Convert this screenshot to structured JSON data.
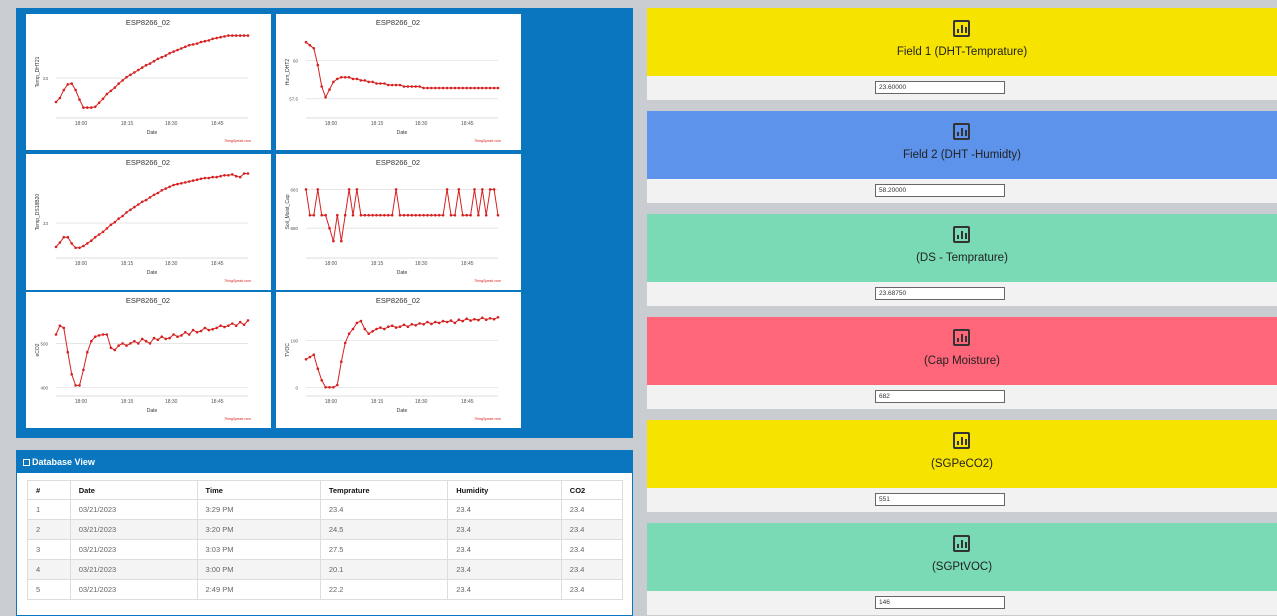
{
  "charts": [
    {
      "title": "ESP8266_02",
      "ylabel": "Temp_DHT21",
      "xlabel": "Date",
      "brand": "ThingSpeak.com",
      "yticks": [
        "23"
      ],
      "xticks": [
        "18:00",
        "18:15",
        "18:30",
        "18:45"
      ]
    },
    {
      "title": "ESP8266_02",
      "ylabel": "Hum_DHT2",
      "xlabel": "Date",
      "brand": "ThingSpeak.com",
      "yticks": [
        "60",
        "57.5"
      ],
      "xticks": [
        "18:00",
        "18:15",
        "18:30",
        "18:45"
      ]
    },
    {
      "title": "ESP8266_02",
      "ylabel": "Temp_DS18B20",
      "xlabel": "Date",
      "brand": "ThingSpeak.com",
      "yticks": [
        "23"
      ],
      "xticks": [
        "18:00",
        "18:15",
        "18:30",
        "18:45"
      ]
    },
    {
      "title": "ESP8266_02",
      "ylabel": "Soil_Moist_Cap",
      "xlabel": "Date",
      "brand": "ThingSpeak.com",
      "yticks": [
        "683",
        "680"
      ],
      "xticks": [
        "18:00",
        "18:15",
        "18:30",
        "18:45"
      ]
    },
    {
      "title": "ESP8266_02",
      "ylabel": "eCO2",
      "xlabel": "Date",
      "brand": "ThingSpeak.com",
      "yticks": [
        "500",
        "400"
      ],
      "xticks": [
        "18:00",
        "18:15",
        "18:30",
        "18:45"
      ]
    },
    {
      "title": "ESP8266_02",
      "ylabel": "TVOC",
      "xlabel": "Date",
      "brand": "ThingSpeak.com",
      "yticks": [
        "100",
        "0"
      ],
      "xticks": [
        "18:00",
        "18:15",
        "18:30",
        "18:45"
      ]
    }
  ],
  "chart_data": [
    {
      "type": "line",
      "title": "ESP8266_02",
      "xlabel": "Date",
      "ylabel": "Temp_DHT21",
      "color": "#d62020",
      "x": [
        0,
        1,
        2,
        3,
        4,
        5,
        6,
        7,
        8,
        9,
        10,
        11,
        12,
        13,
        14,
        15,
        16,
        17,
        18,
        19,
        20,
        21,
        22,
        23,
        24,
        25,
        26,
        27,
        28,
        29,
        30,
        31,
        32,
        33,
        34,
        35,
        36,
        37,
        38,
        39,
        40,
        41,
        42,
        43,
        44,
        45,
        46,
        47,
        48,
        49
      ],
      "y": [
        20.0,
        20.5,
        21.5,
        22.2,
        22.3,
        21.5,
        20.3,
        19.3,
        19.3,
        19.3,
        19.4,
        19.9,
        20.4,
        21.0,
        21.4,
        21.8,
        22.3,
        22.7,
        23.1,
        23.4,
        23.7,
        24.0,
        24.3,
        24.6,
        24.8,
        25.1,
        25.4,
        25.6,
        25.8,
        26.1,
        26.3,
        26.5,
        26.7,
        26.9,
        27.1,
        27.2,
        27.3,
        27.5,
        27.6,
        27.7,
        27.9,
        28.0,
        28.1,
        28.2,
        28.3,
        28.3,
        28.3,
        28.3,
        28.3,
        28.3
      ]
    },
    {
      "type": "line",
      "title": "ESP8266_02",
      "xlabel": "Date",
      "ylabel": "Hum_DHT2",
      "color": "#d62020",
      "x": [
        0,
        1,
        2,
        3,
        4,
        5,
        6,
        7,
        8,
        9,
        10,
        11,
        12,
        13,
        14,
        15,
        16,
        17,
        18,
        19,
        20,
        21,
        22,
        23,
        24,
        25,
        26,
        27,
        28,
        29,
        30,
        31,
        32,
        33,
        34,
        35,
        36,
        37,
        38,
        39,
        40,
        41,
        42,
        43,
        44,
        45,
        46,
        47,
        48,
        49
      ],
      "y": [
        61.2,
        61.0,
        60.8,
        59.7,
        58.3,
        57.6,
        58.1,
        58.6,
        58.8,
        58.9,
        58.9,
        58.9,
        58.8,
        58.8,
        58.7,
        58.7,
        58.6,
        58.6,
        58.5,
        58.5,
        58.5,
        58.4,
        58.4,
        58.4,
        58.4,
        58.3,
        58.3,
        58.3,
        58.3,
        58.3,
        58.2,
        58.2,
        58.2,
        58.2,
        58.2,
        58.2,
        58.2,
        58.2,
        58.2,
        58.2,
        58.2,
        58.2,
        58.2,
        58.2,
        58.2,
        58.2,
        58.2,
        58.2,
        58.2,
        58.2
      ]
    },
    {
      "type": "line",
      "title": "ESP8266_02",
      "xlabel": "Date",
      "ylabel": "Temp_DS18B20",
      "color": "#d62020",
      "x": [
        0,
        1,
        2,
        3,
        4,
        5,
        6,
        7,
        8,
        9,
        10,
        11,
        12,
        13,
        14,
        15,
        16,
        17,
        18,
        19,
        20,
        21,
        22,
        23,
        24,
        25,
        26,
        27,
        28,
        29,
        30,
        31,
        32,
        33,
        34,
        35,
        36,
        37,
        38,
        39,
        40,
        41,
        42,
        43,
        44,
        45,
        46,
        47,
        48,
        49
      ],
      "y": [
        20.3,
        20.8,
        21.4,
        21.4,
        20.7,
        20.2,
        20.2,
        20.4,
        20.7,
        21.0,
        21.4,
        21.7,
        22.0,
        22.4,
        22.8,
        23.1,
        23.5,
        23.8,
        24.2,
        24.5,
        24.8,
        25.1,
        25.4,
        25.6,
        25.9,
        26.2,
        26.4,
        26.7,
        26.9,
        27.1,
        27.3,
        27.4,
        27.5,
        27.6,
        27.7,
        27.8,
        27.9,
        28.0,
        28.1,
        28.1,
        28.2,
        28.2,
        28.3,
        28.4,
        28.4,
        28.5,
        28.3,
        28.2,
        28.6,
        28.6
      ]
    },
    {
      "type": "line",
      "title": "ESP8266_02",
      "xlabel": "Date",
      "ylabel": "Soil_Moist_Cap",
      "color": "#d62020",
      "x": [
        0,
        1,
        2,
        3,
        4,
        5,
        6,
        7,
        8,
        9,
        10,
        11,
        12,
        13,
        14,
        15,
        16,
        17,
        18,
        19,
        20,
        21,
        22,
        23,
        24,
        25,
        26,
        27,
        28,
        29,
        30,
        31,
        32,
        33,
        34,
        35,
        36,
        37,
        38,
        39,
        40,
        41,
        42,
        43,
        44,
        45,
        46,
        47,
        48,
        49
      ],
      "y": [
        683,
        681,
        681,
        683,
        681,
        681,
        680,
        679,
        681,
        679,
        681,
        683,
        681,
        683,
        681,
        681,
        681,
        681,
        681,
        681,
        681,
        681,
        681,
        683,
        681,
        681,
        681,
        681,
        681,
        681,
        681,
        681,
        681,
        681,
        681,
        681,
        683,
        681,
        681,
        683,
        681,
        681,
        681,
        683,
        681,
        683,
        681,
        683,
        683,
        681
      ]
    },
    {
      "type": "line",
      "title": "ESP8266_02",
      "xlabel": "Date",
      "ylabel": "eCO2",
      "color": "#d62020",
      "x": [
        0,
        1,
        2,
        3,
        4,
        5,
        6,
        7,
        8,
        9,
        10,
        11,
        12,
        13,
        14,
        15,
        16,
        17,
        18,
        19,
        20,
        21,
        22,
        23,
        24,
        25,
        26,
        27,
        28,
        29,
        30,
        31,
        32,
        33,
        34,
        35,
        36,
        37,
        38,
        39,
        40,
        41,
        42,
        43,
        44,
        45,
        46,
        47,
        48,
        49
      ],
      "y": [
        520,
        540,
        535,
        480,
        430,
        405,
        405,
        440,
        480,
        505,
        515,
        518,
        520,
        520,
        490,
        485,
        495,
        500,
        495,
        500,
        505,
        500,
        510,
        505,
        500,
        512,
        508,
        515,
        510,
        512,
        520,
        515,
        518,
        525,
        520,
        530,
        525,
        528,
        535,
        530,
        532,
        535,
        540,
        537,
        540,
        545,
        540,
        548,
        542,
        552
      ]
    },
    {
      "type": "line",
      "title": "ESP8266_02",
      "xlabel": "Date",
      "ylabel": "TVOC",
      "color": "#d62020",
      "x": [
        0,
        1,
        2,
        3,
        4,
        5,
        6,
        7,
        8,
        9,
        10,
        11,
        12,
        13,
        14,
        15,
        16,
        17,
        18,
        19,
        20,
        21,
        22,
        23,
        24,
        25,
        26,
        27,
        28,
        29,
        30,
        31,
        32,
        33,
        34,
        35,
        36,
        37,
        38,
        39,
        40,
        41,
        42,
        43,
        44,
        45,
        46,
        47,
        48,
        49
      ],
      "y": [
        60,
        65,
        70,
        40,
        15,
        0,
        0,
        0,
        5,
        55,
        95,
        115,
        125,
        138,
        142,
        125,
        115,
        120,
        125,
        128,
        125,
        130,
        132,
        128,
        130,
        134,
        130,
        135,
        133,
        137,
        135,
        140,
        136,
        140,
        138,
        142,
        140,
        143,
        138,
        145,
        142,
        147,
        143,
        146,
        144,
        149,
        145,
        148,
        146,
        150
      ]
    }
  ],
  "database": {
    "title": "Database View",
    "columns": [
      "#",
      "Date",
      "Time",
      "Temprature",
      "Humidity",
      "CO2"
    ],
    "rows": [
      [
        "1",
        "03/21/2023",
        "3:29 PM",
        "23.4",
        "23.4",
        "23.4"
      ],
      [
        "2",
        "03/21/2023",
        "3:20 PM",
        "24.5",
        "23.4",
        "23.4"
      ],
      [
        "3",
        "03/21/2023",
        "3:03 PM",
        "27.5",
        "23.4",
        "23.4"
      ],
      [
        "4",
        "03/21/2023",
        "3:00 PM",
        "20.1",
        "23.4",
        "23.4"
      ],
      [
        "5",
        "03/21/2023",
        "2:49 PM",
        "22.2",
        "23.4",
        "23.4"
      ]
    ]
  },
  "fields": [
    {
      "label": "Field 1 (DHT-Temprature)",
      "value": "23.60000",
      "color": "#f7e300"
    },
    {
      "label": "Field 2 (DHT -Humidty)",
      "value": "58.20000",
      "color": "#5d93ea"
    },
    {
      "label": "(DS - Temprature)",
      "value": "23.68750",
      "color": "#79dab5"
    },
    {
      "label": "(Cap Moisture)",
      "value": "682",
      "color": "#ff6679"
    },
    {
      "label": "(SGPeCO2)",
      "value": "551",
      "color": "#f7e300"
    },
    {
      "label": "(SGPtVOC)",
      "value": "146",
      "color": "#79dab5"
    }
  ]
}
